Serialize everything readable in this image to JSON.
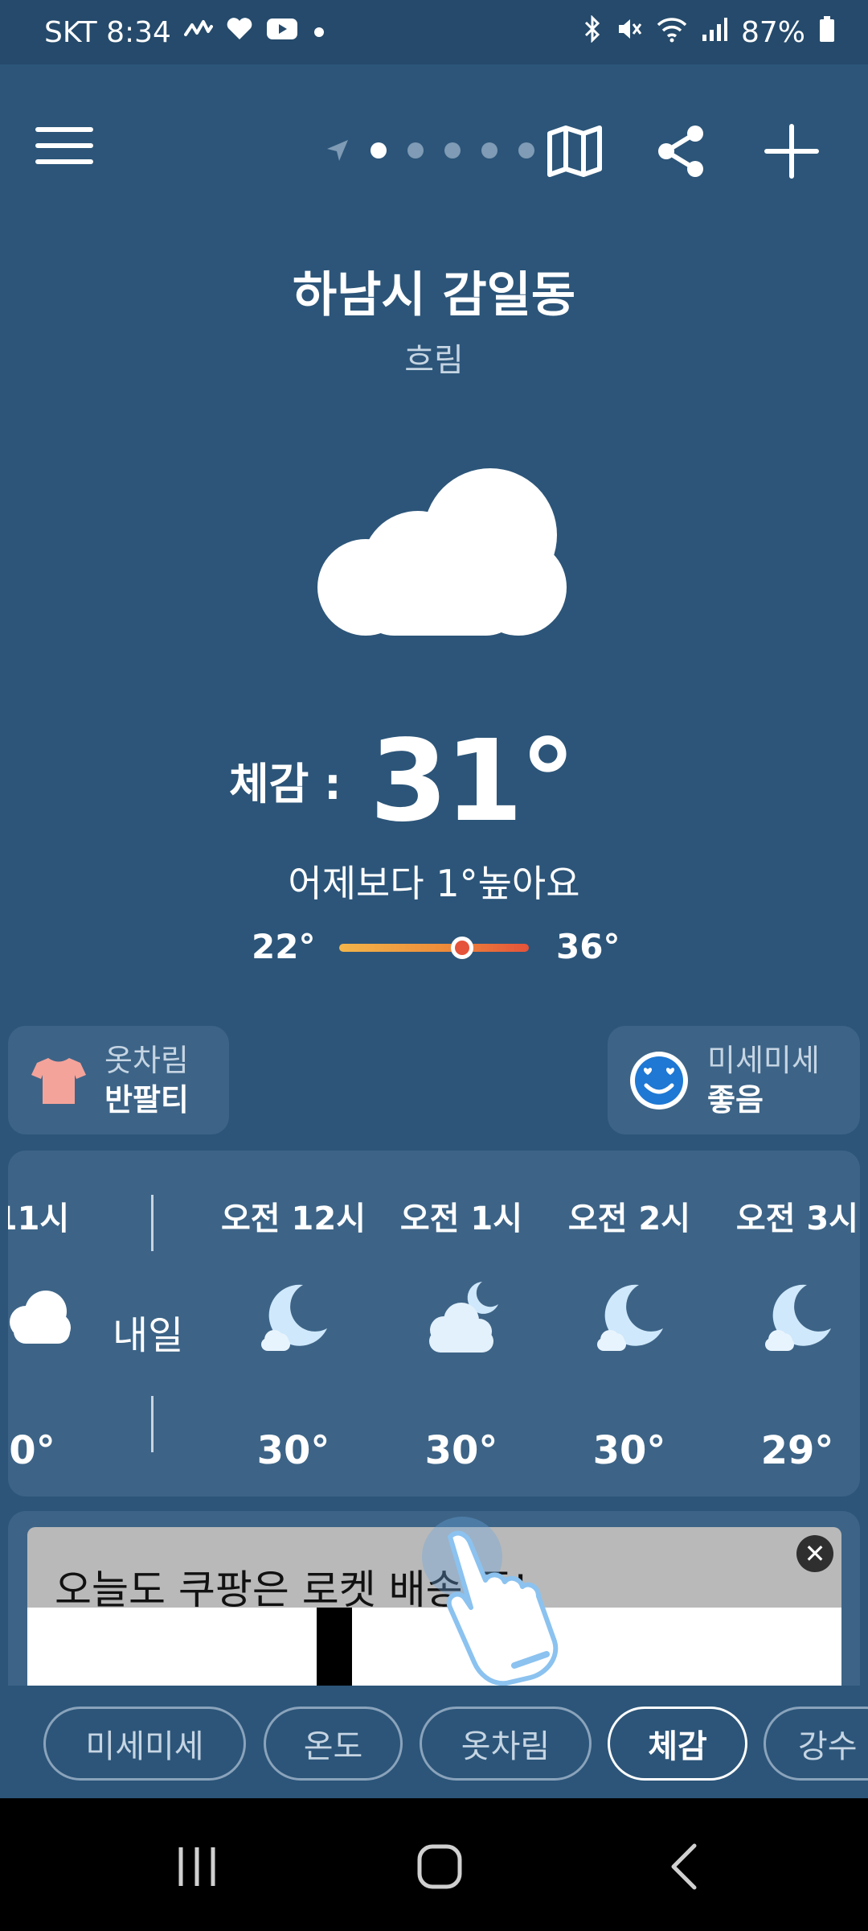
{
  "status_bar": {
    "carrier_time": "SKT 8:34",
    "battery": "87%",
    "left_icons": [
      "activity-icon",
      "heart-icon",
      "youtube-icon",
      "dot-icon"
    ],
    "right_icons": [
      "bluetooth-icon",
      "mute-icon",
      "wifi-icon",
      "signal-icon",
      "battery-icon"
    ]
  },
  "toolbar": {
    "icons": [
      "menu-icon",
      "location-arrow-icon",
      "map-icon",
      "share-icon",
      "plus-icon"
    ],
    "page_count": 5,
    "active_page": 0
  },
  "weather": {
    "location": "하남시 감일동",
    "condition": "흐림",
    "feels_label": "체감 :",
    "feels_temp": "31°",
    "compare": "어제보다 1°높아요",
    "low": "22°",
    "high": "36°",
    "current_position_fraction": 0.65
  },
  "cards": {
    "clothes_title": "옷차림",
    "clothes_value": "반팔티",
    "dust_title": "미세미세",
    "dust_value": "좋음"
  },
  "hourly": {
    "partial_label": "11시",
    "partial_temp": "0°",
    "tomorrow": "내일",
    "hours": [
      {
        "label": "오전 12시",
        "temp": "30°",
        "icon": "moon-cloud-icon"
      },
      {
        "label": "오전 1시",
        "temp": "30°",
        "icon": "cloud-moon-icon"
      },
      {
        "label": "오전 2시",
        "temp": "30°",
        "icon": "moon-cloud-icon"
      },
      {
        "label": "오전 3시",
        "temp": "29°",
        "icon": "moon-cloud-icon"
      }
    ]
  },
  "ad": {
    "headline": "오늘도 쿠팡은 로켓 배송 중!"
  },
  "tabs": [
    "미세미세",
    "온도",
    "옷차림",
    "체감",
    "강수"
  ],
  "active_tab": "체감",
  "colors": {
    "background": "#2c5579",
    "card": "#3d6487",
    "accent_warm": "#e5533a"
  }
}
